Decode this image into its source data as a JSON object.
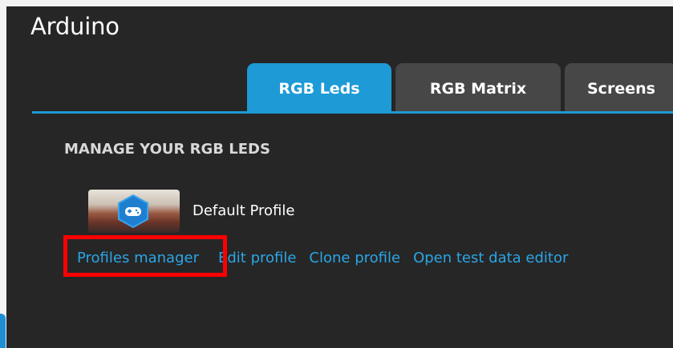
{
  "window": {
    "title": "Arduino"
  },
  "tabs": [
    {
      "label": "RGB Leds",
      "active": true
    },
    {
      "label": "RGB Matrix",
      "active": false
    },
    {
      "label": "Screens",
      "active": false
    }
  ],
  "section": {
    "title": "MANAGE YOUR RGB LEDS"
  },
  "profile": {
    "name": "Default Profile",
    "thumbnail_icon": "gamepad-icon"
  },
  "actions": [
    {
      "label": "Profiles manager"
    },
    {
      "label": "Edit profile"
    },
    {
      "label": "Clone profile"
    },
    {
      "label": "Open test data editor"
    }
  ],
  "colors": {
    "accent": "#1e9ad6",
    "link": "#2aa6e6",
    "panel_bg": "#262626",
    "inactive_tab": "#474747",
    "highlight": "#ff0000"
  }
}
